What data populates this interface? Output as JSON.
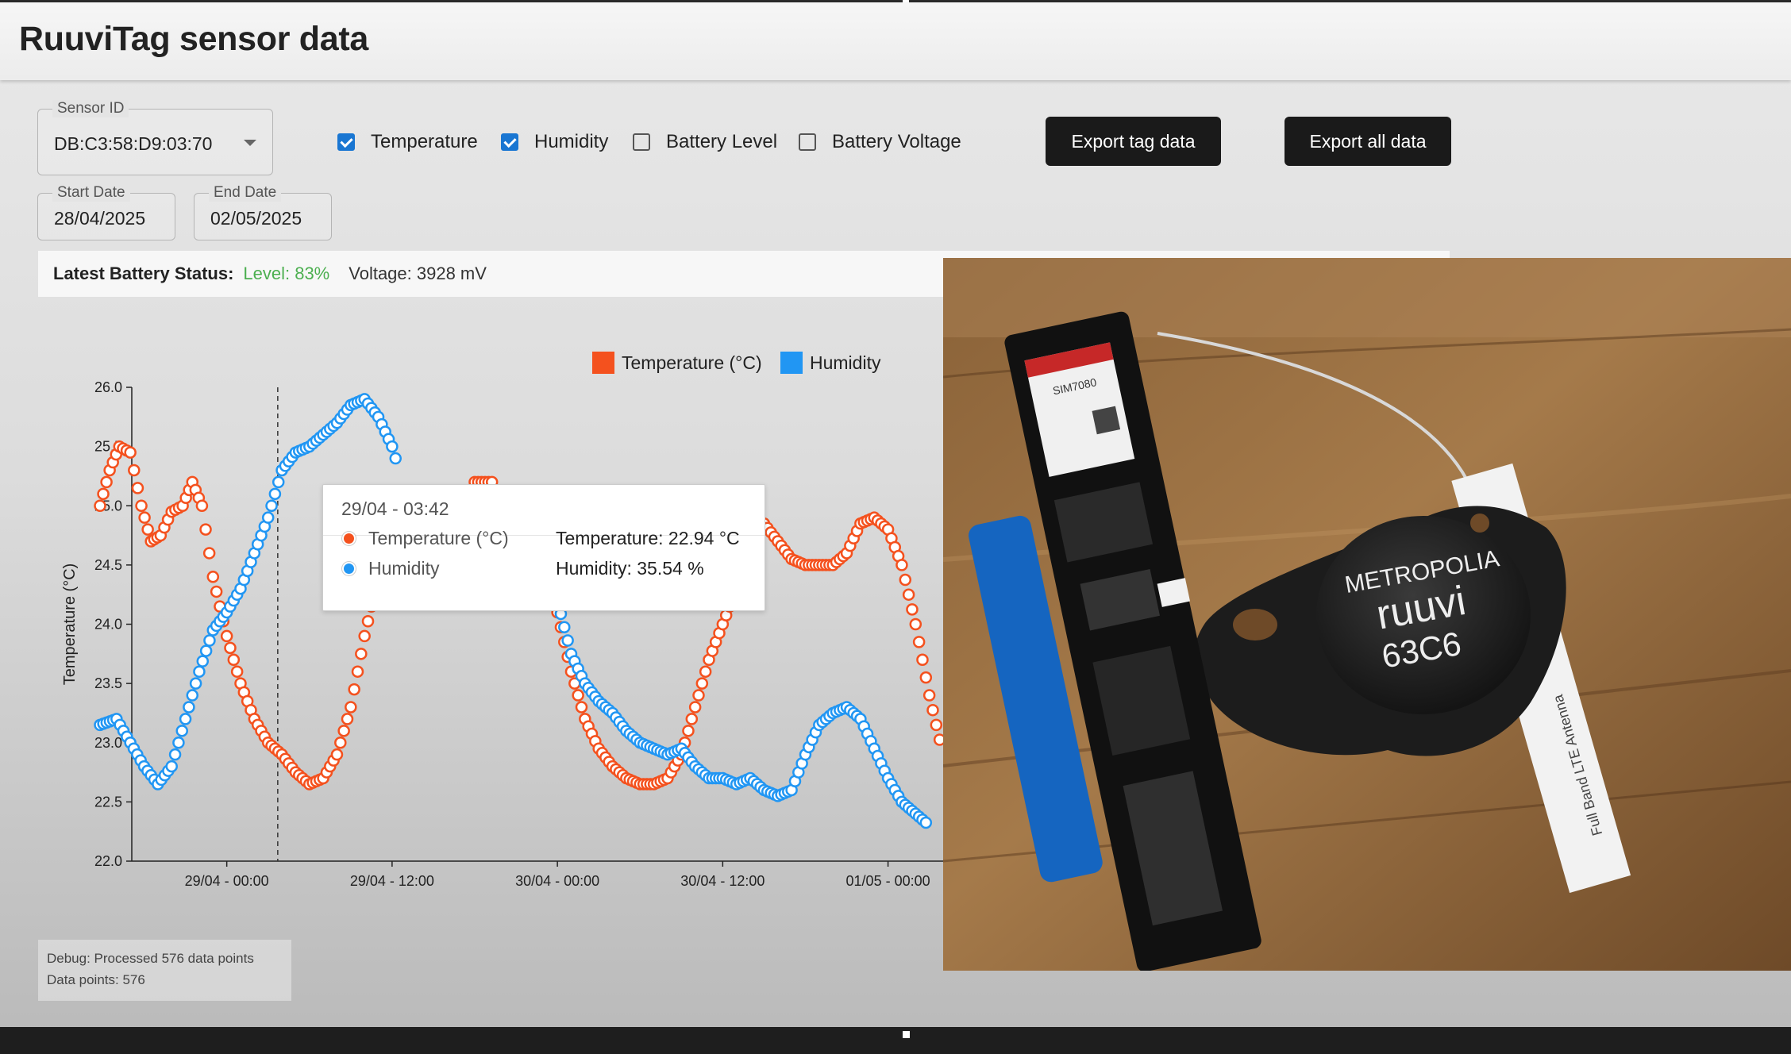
{
  "app": {
    "title": "RuuviTag sensor data"
  },
  "filters": {
    "sensor_label": "Sensor ID",
    "sensor_value": "DB:C3:58:D9:03:70",
    "start_label": "Start Date",
    "start_value": "28/04/2025",
    "end_label": "End Date",
    "end_value": "02/05/2025",
    "checkboxes": [
      {
        "label": "Temperature",
        "checked": true
      },
      {
        "label": "Humidity",
        "checked": true
      },
      {
        "label": "Battery Level",
        "checked": false
      },
      {
        "label": "Battery Voltage",
        "checked": false
      }
    ],
    "export_tag": "Export tag data",
    "export_all": "Export all data"
  },
  "battery": {
    "label": "Latest Battery Status:",
    "level": "Level: 83%",
    "voltage": "Voltage: 3928 mV"
  },
  "tooltip": {
    "title": "29/04 - 03:42",
    "rows": [
      {
        "name": "Temperature (°C)",
        "value": "Temperature: 22.94 °C",
        "color": "#f4511e"
      },
      {
        "name": "Humidity",
        "value": "Humidity: 35.54 %",
        "color": "#2196f3"
      }
    ]
  },
  "debug": {
    "line1": "Debug: Processed 576 data points",
    "line2": "Data points: 576"
  },
  "colors": {
    "temperature": "#f4511e",
    "humidity": "#2196f3",
    "level_green": "#4caf50"
  },
  "photo": {
    "module_text": "SIM7080",
    "tag_text_1": "METROPOLIA",
    "tag_text_2": "ruuvi",
    "tag_text_3": "63C6",
    "antenna_text": "Full Band LTE Antenna"
  },
  "chart_data": {
    "type": "scatter",
    "ylabel": "Temperature (°C)",
    "ylim": [
      22.0,
      26.0
    ],
    "yticks": [
      "26.0",
      "25.5",
      "25.0",
      "24.5",
      "24.0",
      "23.5",
      "23.0",
      "22.5",
      "22.0"
    ],
    "xticks": [
      "29/04 - 00:00",
      "29/04 - 12:00",
      "30/04 - 00:00",
      "30/04 - 12:00",
      "01/05 - 00:00"
    ],
    "xrange_hours": [
      -9.2,
      52.0
    ],
    "cursor_hour": 3.7,
    "legend": "top-right",
    "series": [
      {
        "name": "Temperature (°C)",
        "color": "#f4511e",
        "points": [
          [
            -9.2,
            25.0
          ],
          [
            -8.5,
            25.3
          ],
          [
            -7.8,
            25.5
          ],
          [
            -7.0,
            25.45
          ],
          [
            -6.2,
            25.0
          ],
          [
            -5.5,
            24.7
          ],
          [
            -4.8,
            24.75
          ],
          [
            -4.0,
            24.95
          ],
          [
            -3.2,
            25.0
          ],
          [
            -2.5,
            25.2
          ],
          [
            -1.8,
            25.0
          ],
          [
            -1.0,
            24.4
          ],
          [
            0.0,
            23.9
          ],
          [
            1.0,
            23.5
          ],
          [
            2.0,
            23.2
          ],
          [
            3.0,
            23.0
          ],
          [
            4.0,
            22.9
          ],
          [
            5.0,
            22.75
          ],
          [
            6.0,
            22.65
          ],
          [
            7.0,
            22.7
          ],
          [
            8.0,
            22.9
          ],
          [
            9.0,
            23.3
          ],
          [
            10.0,
            23.9
          ],
          [
            11.0,
            24.4
          ],
          [
            11.8,
            24.8
          ],
          [
            18.0,
            25.2
          ],
          [
            19.5,
            25.2
          ],
          [
            24.0,
            24.1
          ],
          [
            25.0,
            23.6
          ],
          [
            26.0,
            23.2
          ],
          [
            27.0,
            22.95
          ],
          [
            28.0,
            22.8
          ],
          [
            29.0,
            22.7
          ],
          [
            30.0,
            22.65
          ],
          [
            31.0,
            22.65
          ],
          [
            32.0,
            22.7
          ],
          [
            33.0,
            22.9
          ],
          [
            34.0,
            23.3
          ],
          [
            35.0,
            23.7
          ],
          [
            36.0,
            24.0
          ],
          [
            37.0,
            24.3
          ],
          [
            38.0,
            24.6
          ],
          [
            39.0,
            24.85
          ],
          [
            40.0,
            24.7
          ],
          [
            41.0,
            24.55
          ],
          [
            42.0,
            24.5
          ],
          [
            43.0,
            24.5
          ],
          [
            44.0,
            24.5
          ],
          [
            45.0,
            24.6
          ],
          [
            46.0,
            24.85
          ],
          [
            47.0,
            24.9
          ],
          [
            48.0,
            24.8
          ],
          [
            49.0,
            24.5
          ],
          [
            50.0,
            24.0
          ],
          [
            51.0,
            23.4
          ],
          [
            52.0,
            22.9
          ]
        ]
      },
      {
        "name": "Humidity",
        "color": "#2196f3",
        "points": [
          [
            -9.2,
            23.15
          ],
          [
            -8.0,
            23.2
          ],
          [
            -7.0,
            23.0
          ],
          [
            -6.0,
            22.8
          ],
          [
            -5.0,
            22.65
          ],
          [
            -4.0,
            22.8
          ],
          [
            -3.0,
            23.2
          ],
          [
            -2.0,
            23.6
          ],
          [
            -1.0,
            23.95
          ],
          [
            0.0,
            24.1
          ],
          [
            1.0,
            24.3
          ],
          [
            2.0,
            24.6
          ],
          [
            3.0,
            24.9
          ],
          [
            4.0,
            25.3
          ],
          [
            5.0,
            25.45
          ],
          [
            6.0,
            25.5
          ],
          [
            7.0,
            25.6
          ],
          [
            8.0,
            25.7
          ],
          [
            9.0,
            25.85
          ],
          [
            10.0,
            25.9
          ],
          [
            11.0,
            25.75
          ],
          [
            12.0,
            25.5
          ],
          [
            12.5,
            25.3
          ],
          [
            24.0,
            24.2
          ],
          [
            25.0,
            23.75
          ],
          [
            26.0,
            23.5
          ],
          [
            27.0,
            23.35
          ],
          [
            28.0,
            23.25
          ],
          [
            29.0,
            23.1
          ],
          [
            30.0,
            23.0
          ],
          [
            31.0,
            22.95
          ],
          [
            32.0,
            22.9
          ],
          [
            33.0,
            22.95
          ],
          [
            34.0,
            22.8
          ],
          [
            35.0,
            22.7
          ],
          [
            36.0,
            22.7
          ],
          [
            37.0,
            22.65
          ],
          [
            38.0,
            22.7
          ],
          [
            39.0,
            22.6
          ],
          [
            40.0,
            22.55
          ],
          [
            41.0,
            22.6
          ],
          [
            42.0,
            22.9
          ],
          [
            43.0,
            23.15
          ],
          [
            44.0,
            23.25
          ],
          [
            45.0,
            23.3
          ],
          [
            46.0,
            23.2
          ],
          [
            47.0,
            22.95
          ],
          [
            48.0,
            22.7
          ],
          [
            49.0,
            22.5
          ],
          [
            50.0,
            22.4
          ],
          [
            51.0,
            22.3
          ]
        ]
      }
    ]
  }
}
